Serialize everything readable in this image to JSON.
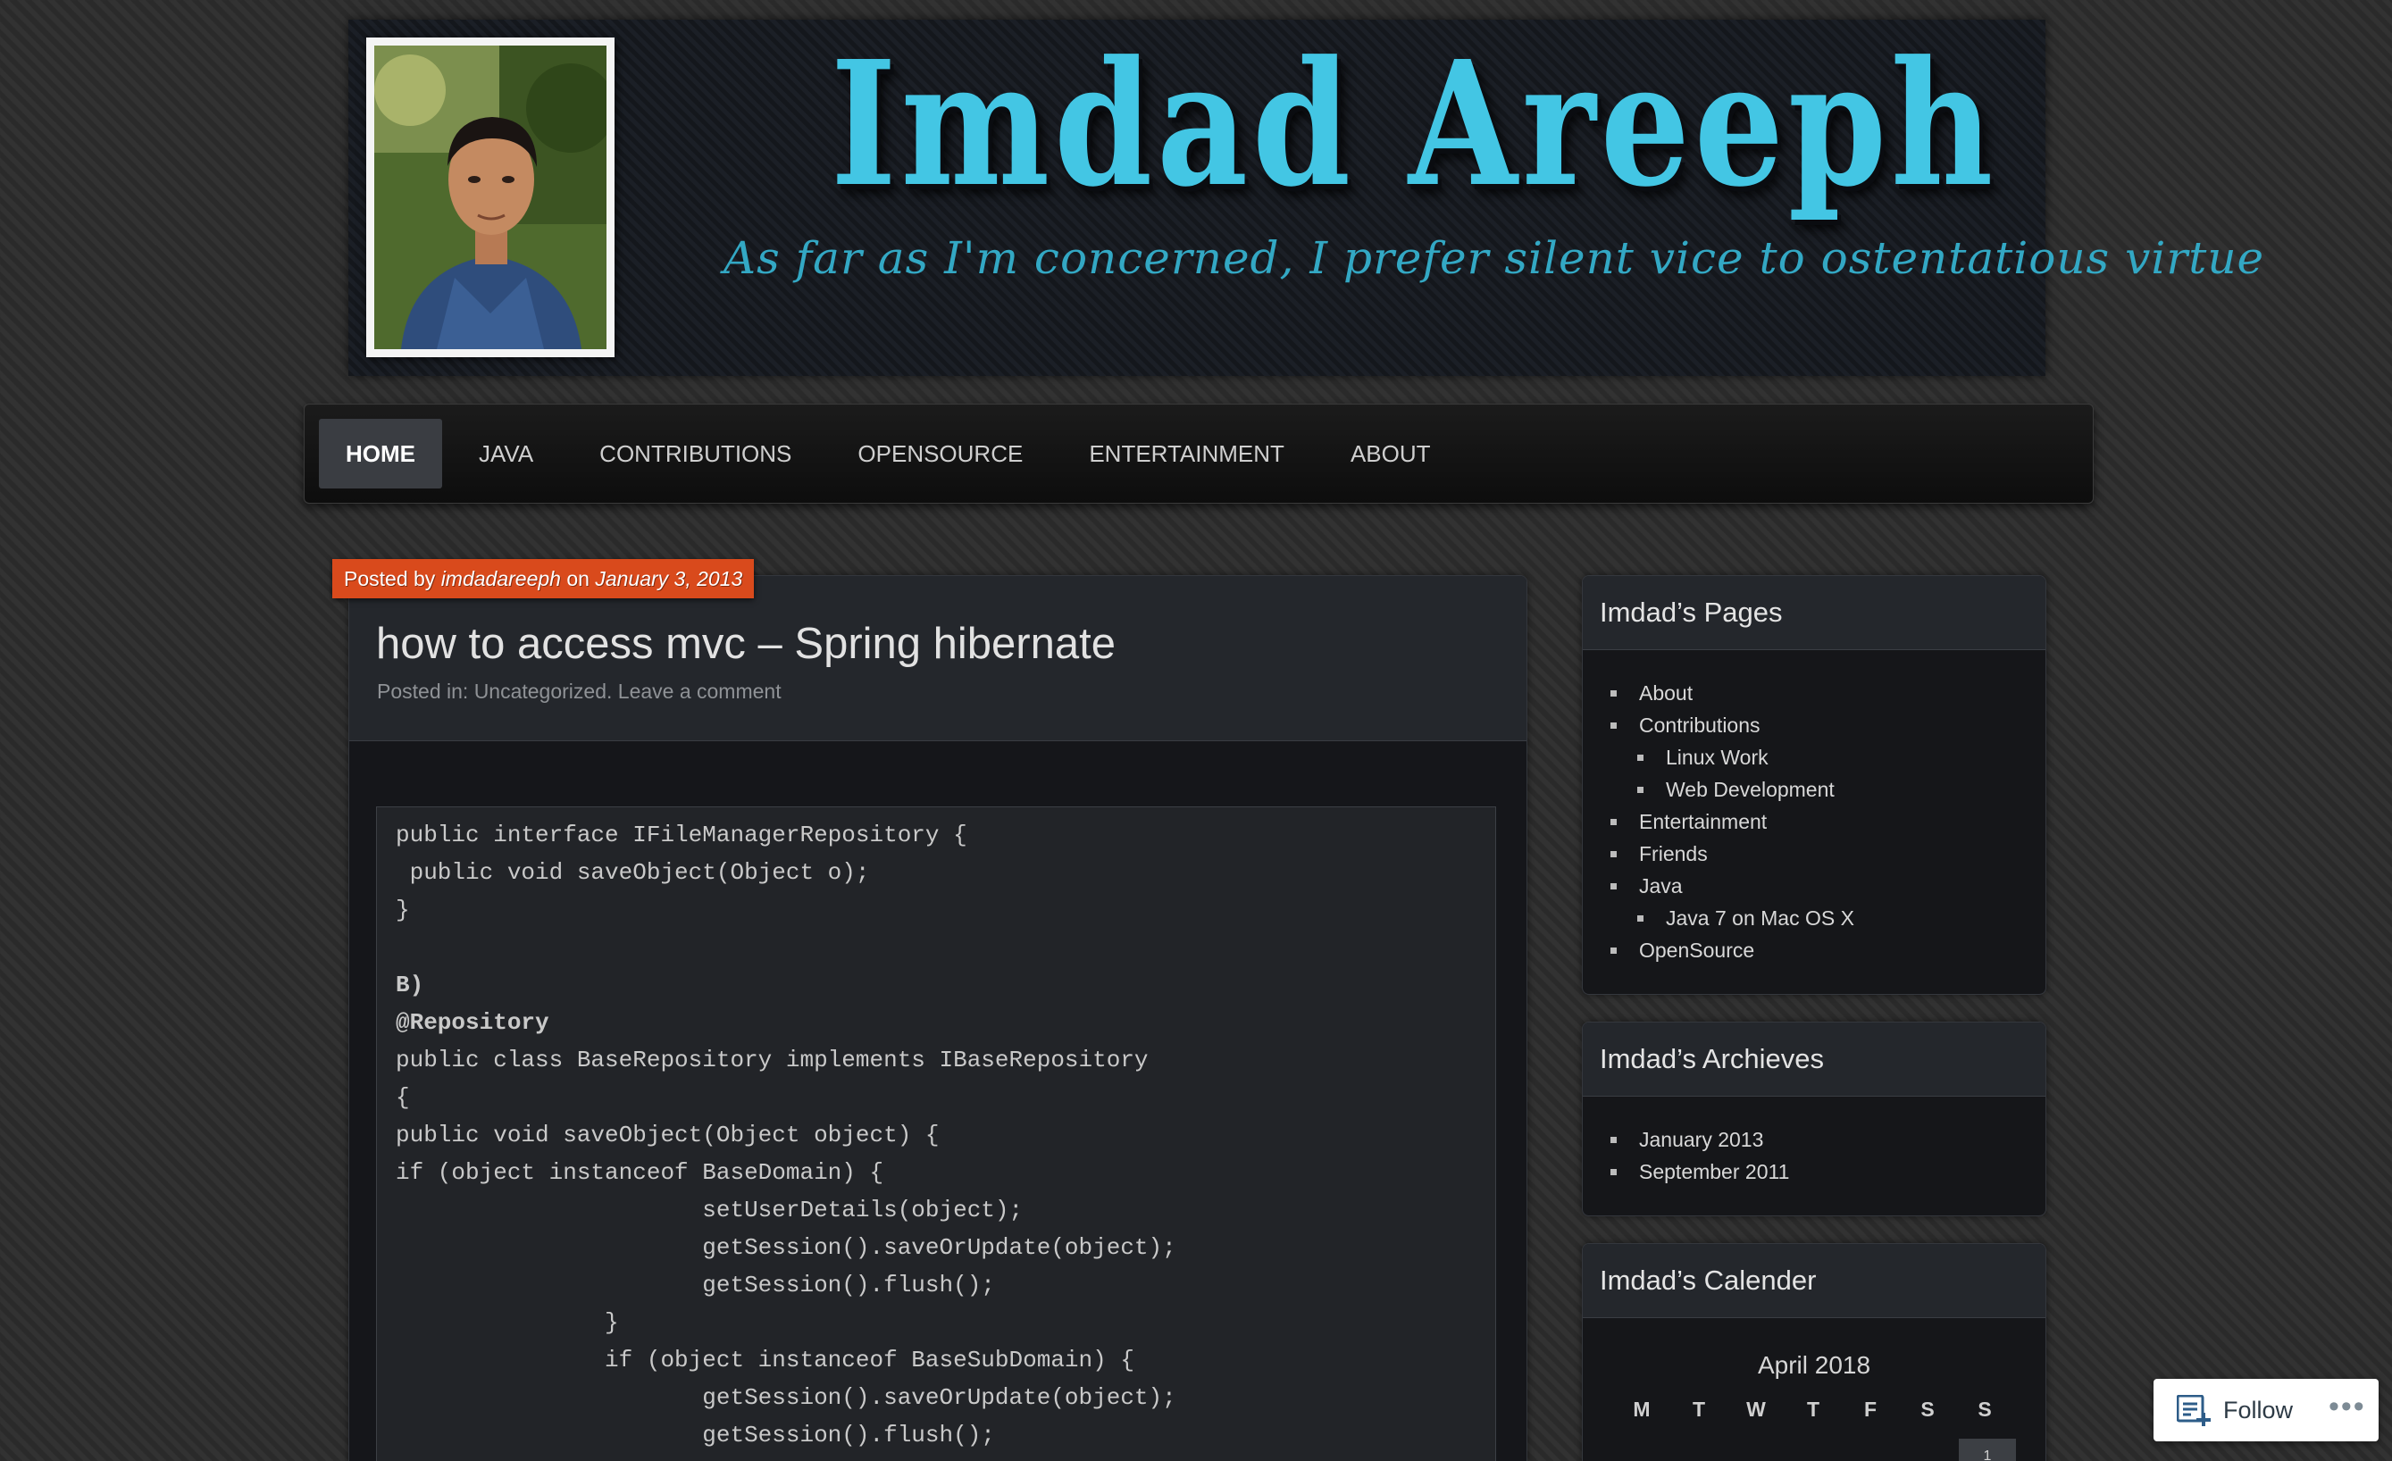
{
  "header": {
    "title": "Imdad Areeph",
    "tagline": "As far as I'm concerned, I prefer silent vice to ostentatious virtue"
  },
  "nav": {
    "items": [
      {
        "label": "HOME",
        "active": true
      },
      {
        "label": "JAVA"
      },
      {
        "label": "CONTRIBUTIONS"
      },
      {
        "label": "OPENSOURCE"
      },
      {
        "label": "ENTERTAINMENT"
      },
      {
        "label": "ABOUT"
      }
    ]
  },
  "post": {
    "posted_prefix": "Posted by",
    "author": "imdadareeph",
    "on": "on",
    "date": "January 3, 2013",
    "title": "how to access mvc – Spring hibernate",
    "posted_in_label": "Posted in:",
    "category": "Uncategorized.",
    "comment_link": "Leave a comment",
    "code_lines": [
      "public interface IFileManagerRepository {",
      " public void saveObject(Object o);",
      "}",
      "",
      "B)",
      "@Repository",
      "public class BaseRepository implements IBaseRepository",
      "{",
      "public void saveObject(Object object) {",
      "if (object instanceof BaseDomain) {",
      "                      setUserDetails(object);",
      "                      getSession().saveOrUpdate(object);",
      "                      getSession().flush();",
      "               }",
      "               if (object instanceof BaseSubDomain) {",
      "                      getSession().saveOrUpdate(object);",
      "                      getSession().flush();"
    ]
  },
  "sidebar": {
    "pages": {
      "title": "Imdad’s Pages",
      "items": [
        {
          "label": "About",
          "level": 1
        },
        {
          "label": "Contributions",
          "level": 1
        },
        {
          "label": "Linux Work",
          "level": 2
        },
        {
          "label": "Web Development",
          "level": 2
        },
        {
          "label": "Entertainment",
          "level": 1
        },
        {
          "label": "Friends",
          "level": 1
        },
        {
          "label": "Java",
          "level": 1
        },
        {
          "label": "Java 7 on Mac OS X",
          "level": 2
        },
        {
          "label": "OpenSource",
          "level": 1
        }
      ]
    },
    "archives": {
      "title": "Imdad’s Archieves",
      "items": [
        "January 2013",
        "September 2011"
      ]
    },
    "calendar": {
      "title": "Imdad’s Calender",
      "month": "April 2018",
      "days": [
        "M",
        "T",
        "W",
        "T",
        "F",
        "S",
        "S"
      ],
      "first_day": "1"
    }
  },
  "follow": {
    "label": "Follow",
    "more": "•••"
  }
}
